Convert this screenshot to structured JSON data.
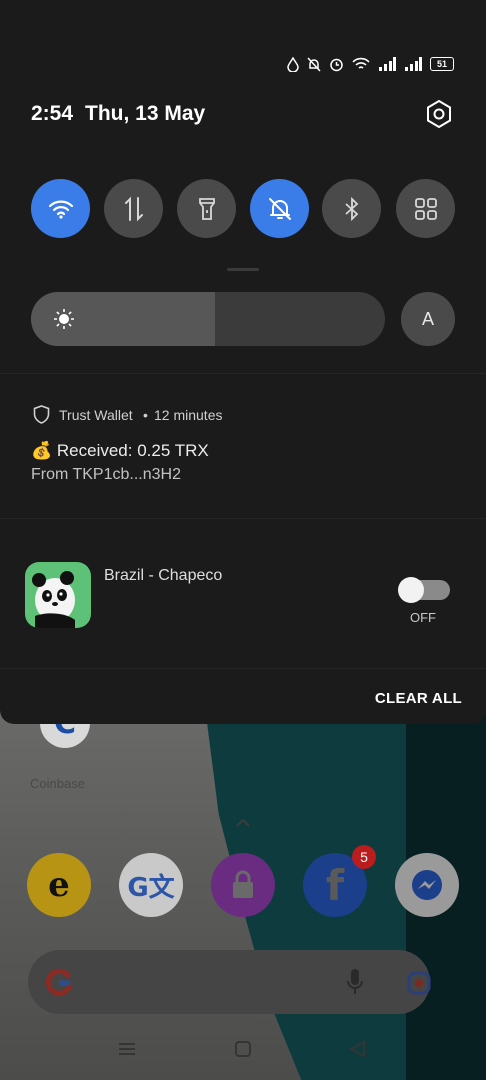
{
  "status_bar": {
    "battery_level": "51",
    "icons": [
      "data-saver-icon",
      "bell-off-icon",
      "alarm-icon",
      "wifi-icon",
      "signal-icon",
      "signal-icon-2",
      "battery-icon"
    ]
  },
  "header": {
    "time": "2:54",
    "date": "Thu, 13 May",
    "settings_icon": "gear-icon"
  },
  "quick_settings": {
    "tiles": [
      {
        "name": "wifi",
        "icon": "wifi-icon",
        "active": true
      },
      {
        "name": "mobile-data",
        "icon": "mobile-data-icon",
        "active": false
      },
      {
        "name": "flashlight",
        "icon": "flashlight-icon",
        "active": false
      },
      {
        "name": "do-not-disturb",
        "icon": "bell-off-icon",
        "active": true
      },
      {
        "name": "bluetooth",
        "icon": "bluetooth-icon",
        "active": false
      },
      {
        "name": "more-tiles",
        "icon": "grid-icon",
        "active": false
      }
    ],
    "brightness_level": 0.52,
    "auto_brightness_label": "A"
  },
  "notifications": [
    {
      "app": "Trust Wallet",
      "separator": "•",
      "time": "12 minutes",
      "title": "💰 Received: 0.25 TRX",
      "body": "From TKP1cb...n3H2"
    },
    {
      "title": "Brazil - Chapeco",
      "toggle_state": "OFF"
    }
  ],
  "clear_all_label": "CLEAR ALL",
  "home_screen": {
    "app_label": "Coinbase",
    "badge_count": "5"
  },
  "colors": {
    "accent": "#3a7ce8",
    "shade_bg": "#1b1b1b",
    "tile_off": "#4a4a4a"
  }
}
